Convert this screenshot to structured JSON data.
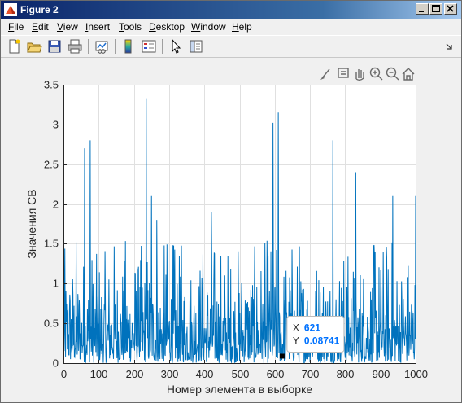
{
  "window": {
    "title": "Figure 2"
  },
  "menu": [
    "File",
    "Edit",
    "View",
    "Insert",
    "Tools",
    "Desktop",
    "Window",
    "Help"
  ],
  "menu_hotkeys": [
    "F",
    "E",
    "V",
    "I",
    "T",
    "D",
    "W",
    "H"
  ],
  "toolbar_icons": [
    "new-figure-icon",
    "open-file-icon",
    "save-icon",
    "print-icon",
    "link-plot-icon",
    "colorbar-icon",
    "legend-icon",
    "pointer-icon",
    "property-editor-icon"
  ],
  "axes_toolbar_icons": [
    "brush-icon",
    "datatip-icon",
    "pan-icon",
    "zoom-in-icon",
    "zoom-out-icon",
    "home-icon"
  ],
  "colors": {
    "series": "#0072bd",
    "datatip_value": "#0072ff",
    "grid": "#e0e0e0"
  },
  "chart_data": {
    "type": "line",
    "title": "",
    "xlabel": "Номер элемента в выборке",
    "ylabel": "Значения СВ",
    "xlim": [
      0,
      1000
    ],
    "ylim": [
      0,
      3.5
    ],
    "xticks": [
      0,
      100,
      200,
      300,
      400,
      500,
      600,
      700,
      800,
      900,
      1000
    ],
    "yticks": [
      0,
      0.5,
      1,
      1.5,
      2,
      2.5,
      3,
      3.5
    ],
    "xtick_labels": [
      "0",
      "100",
      "200",
      "300",
      "400",
      "500",
      "600",
      "700",
      "800",
      "900",
      "1000"
    ],
    "ytick_labels": [
      "0",
      "0.5",
      "1",
      "1.5",
      "2",
      "2.5",
      "3",
      "3.5"
    ],
    "grid": true,
    "series": [
      {
        "n_points": 1000,
        "notable_peaks": [
          {
            "x": 1,
            "y": 1.9
          },
          {
            "x": 60,
            "y": 2.7
          },
          {
            "x": 76,
            "y": 2.8
          },
          {
            "x": 235,
            "y": 3.33
          },
          {
            "x": 250,
            "y": 2.1
          },
          {
            "x": 265,
            "y": 1.8
          },
          {
            "x": 420,
            "y": 1.9
          },
          {
            "x": 595,
            "y": 3.02
          },
          {
            "x": 610,
            "y": 3.15
          },
          {
            "x": 765,
            "y": 2.8
          },
          {
            "x": 830,
            "y": 2.4
          },
          {
            "x": 885,
            "y": 1.4
          },
          {
            "x": 935,
            "y": 2.1
          },
          {
            "x": 1000,
            "y": 2.1
          }
        ]
      }
    ],
    "datatip": {
      "x": 621,
      "y": 0.08741,
      "x_label": "X",
      "y_label": "Y",
      "x_text": "621",
      "y_text": "0.08741"
    }
  }
}
